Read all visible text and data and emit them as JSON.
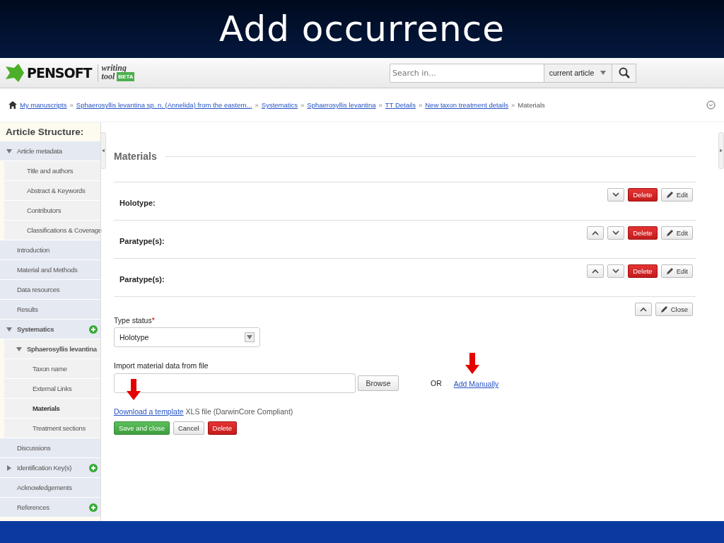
{
  "slide_title": "Add occurrence",
  "header": {
    "logo": "PENSOFT",
    "tool_name_1": "writing",
    "tool_name_2": "tool",
    "badge": "BETA",
    "search": {
      "placeholder": "Search in..."
    },
    "scope": "current article"
  },
  "breadcrumb": [
    {
      "label": "My manuscripts",
      "link": true
    },
    {
      "separator": "»",
      "label": "Sphaerosyllis levantina sp. n. (Annelida) from the eastern...",
      "link": true
    },
    {
      "separator": "»",
      "label": "Systematics",
      "link": true
    },
    {
      "separator": "»",
      "label": "Sphaerosyllis levantina",
      "link": true
    },
    {
      "separator": "»",
      "label": "TT Details",
      "link": true
    },
    {
      "separator": "»",
      "label": "New taxon treatment details",
      "link": true
    },
    {
      "separator": "»",
      "label": "Materials",
      "link": false
    }
  ],
  "sidebar": {
    "title": "Article Structure:",
    "items": [
      {
        "label": "Article metadata",
        "selected": false,
        "expanded": true,
        "can_add": false,
        "children": [
          {
            "label": "Title and authors",
            "selected": false
          },
          {
            "label": "Abstract & Keywords",
            "selected": false
          },
          {
            "label": "Contributors",
            "selected": false
          },
          {
            "label": "Classifications & Coverage",
            "selected": false
          }
        ]
      },
      {
        "label": "Introduction",
        "selected": false
      },
      {
        "label": "Material and Methods",
        "selected": false
      },
      {
        "label": "Data resources",
        "selected": false
      },
      {
        "label": "Results",
        "selected": false
      },
      {
        "label": "Systematics",
        "selected": false,
        "expanded": true,
        "can_add": true,
        "children": [
          {
            "label": "Sphaerosyllis levantina",
            "selected": false,
            "expanded": true,
            "can_add": false,
            "children": [
              {
                "label": "Taxon name",
                "selected": false
              },
              {
                "label": "External Links",
                "selected": false
              },
              {
                "label": "Materials",
                "selected": true
              },
              {
                "label": "Treatment sections",
                "selected": false
              }
            ]
          }
        ]
      },
      {
        "label": "Discussions",
        "selected": false
      },
      {
        "label": "Identification Key(s)",
        "selected": false,
        "expanded": false,
        "can_add": true
      },
      {
        "label": "Acknowledgements",
        "selected": false
      },
      {
        "label": "References",
        "selected": false,
        "can_add": true
      }
    ]
  },
  "section_title": "Materials",
  "records": [
    {
      "label": "Holotype:",
      "can_move_up": false,
      "can_move_down": true,
      "delete": "Delete",
      "edit": "Edit"
    },
    {
      "label": "Paratype(s):",
      "can_move_up": true,
      "can_move_down": true,
      "delete": "Delete",
      "edit": "Edit"
    },
    {
      "label": "Paratype(s):",
      "can_move_up": true,
      "can_move_down": true,
      "delete": "Delete",
      "edit": "Edit"
    }
  ],
  "editor": {
    "can_move_up": true,
    "close": "Close",
    "type_status_label": "Type status",
    "required_mark": "*",
    "type_status_value": "Holotype",
    "import_label": "Import material data from file",
    "browse": "Browse",
    "or": "OR",
    "add_manually": "Add Manually",
    "download_link": "Download a template",
    "download_note": "XLS file (DarwinCore Compliant)",
    "save": "Save and close",
    "cancel": "Cancel",
    "delete": "Delete"
  }
}
